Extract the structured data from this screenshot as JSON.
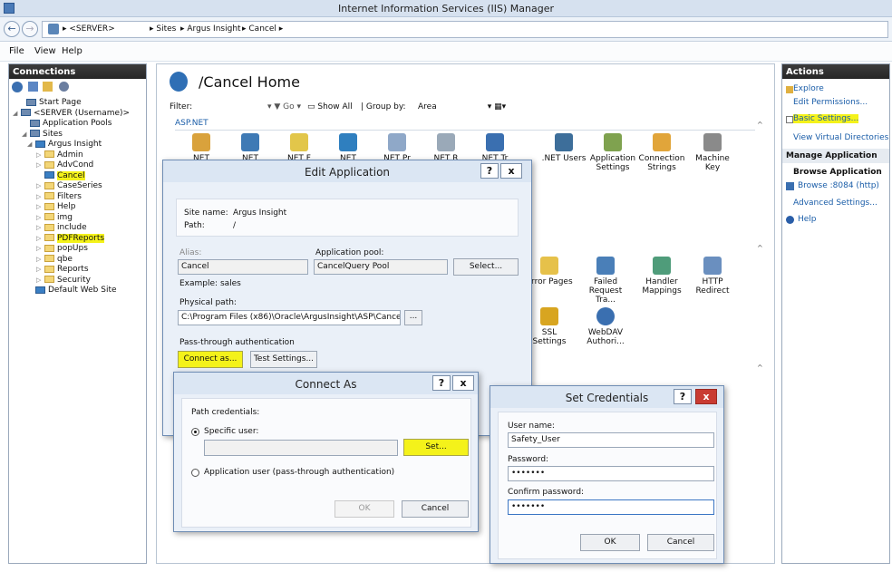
{
  "window": {
    "title": "Internet Information Services (IIS) Manager"
  },
  "address": {
    "crumbs": [
      "<SERVER>",
      "Sites",
      "Argus Insight",
      "Cancel"
    ]
  },
  "menu": [
    "File",
    "View",
    "Help"
  ],
  "connections": {
    "header": "Connections",
    "tree": [
      {
        "label": "Start Page",
        "icon": "start-page-icon"
      },
      {
        "label": "<SERVER (Username)>",
        "icon": "server-icon"
      },
      {
        "label": "Application Pools",
        "icon": "app-pools-icon"
      },
      {
        "label": "Sites",
        "icon": "sites-icon"
      },
      {
        "label": "Argus Insight",
        "icon": "globe-icon"
      },
      {
        "label": "Admin",
        "icon": "folder-icon"
      },
      {
        "label": "AdvCond",
        "icon": "folder-icon"
      },
      {
        "label": "Cancel",
        "icon": "app-icon"
      },
      {
        "label": "CaseSeries",
        "icon": "folder-icon"
      },
      {
        "label": "Filters",
        "icon": "folder-icon"
      },
      {
        "label": "Help",
        "icon": "folder-icon"
      },
      {
        "label": "img",
        "icon": "folder-icon"
      },
      {
        "label": "include",
        "icon": "folder-icon"
      },
      {
        "label": "PDFReports",
        "icon": "folder-icon"
      },
      {
        "label": "popUps",
        "icon": "folder-icon"
      },
      {
        "label": "qbe",
        "icon": "folder-icon"
      },
      {
        "label": "Reports",
        "icon": "folder-icon"
      },
      {
        "label": "Security",
        "icon": "folder-icon"
      },
      {
        "label": "Default Web Site",
        "icon": "globe-icon"
      }
    ]
  },
  "center": {
    "title": "/Cancel Home",
    "filter_label": "Filter:",
    "go": "Go",
    "show_all": "Show All",
    "group_by_label": "Group by:",
    "group_by_value": "Area",
    "section": "ASP.NET",
    "features_row1": [
      ".NET Users",
      "Application Settings",
      "Connection Strings",
      "Machine Key"
    ],
    "features_row1_partial": [
      "NET",
      "NET",
      "NET F",
      "NET",
      "NET Pr",
      "NET R",
      "NET Tr"
    ],
    "features_iis": [
      "Error Pages",
      "Failed Request Tra...",
      "Handler Mappings",
      "HTTP Redirect",
      "SSL Settings",
      "WebDAV Authori..."
    ]
  },
  "actions": {
    "header": "Actions",
    "items": [
      "Explore",
      "Edit Permissions...",
      "Basic Settings...",
      "View Virtual Directories"
    ],
    "manage_header": "Manage Application",
    "browse_header": "Browse Application",
    "browse_link": "Browse :8084 (http)",
    "advanced": "Advanced Settings...",
    "help": "Help"
  },
  "edit_app": {
    "title": "Edit Application",
    "site_name_label": "Site name:",
    "site_name": "Argus Insight",
    "path_label": "Path:",
    "path": "/",
    "alias_label": "Alias:",
    "alias": "Cancel",
    "pool_label": "Application pool:",
    "pool": "CancelQuery Pool",
    "select": "Select...",
    "example": "Example: sales",
    "physical_label": "Physical path:",
    "physical_path": "C:\\Program Files (x86)\\Oracle\\ArgusInsight\\ASP\\Cancel",
    "browse": "...",
    "passthrough": "Pass-through authentication",
    "connect_as": "Connect as...",
    "test": "Test Settings..."
  },
  "connect_as": {
    "title": "Connect As",
    "path_credentials": "Path credentials:",
    "specific_user": "Specific user:",
    "set": "Set...",
    "app_user": "Application user (pass-through authentication)",
    "ok": "OK",
    "cancel": "Cancel"
  },
  "set_credentials": {
    "title": "Set Credentials",
    "user_label": "User name:",
    "user": "Safety_User",
    "password_label": "Password:",
    "password": "•••••••",
    "confirm_label": "Confirm password:",
    "confirm": "•••••••",
    "ok": "OK",
    "cancel": "Cancel"
  },
  "colors": {
    "highlight": "#f4f21a",
    "link": "#1a5da8",
    "panel_header": "#2d2d2d"
  }
}
